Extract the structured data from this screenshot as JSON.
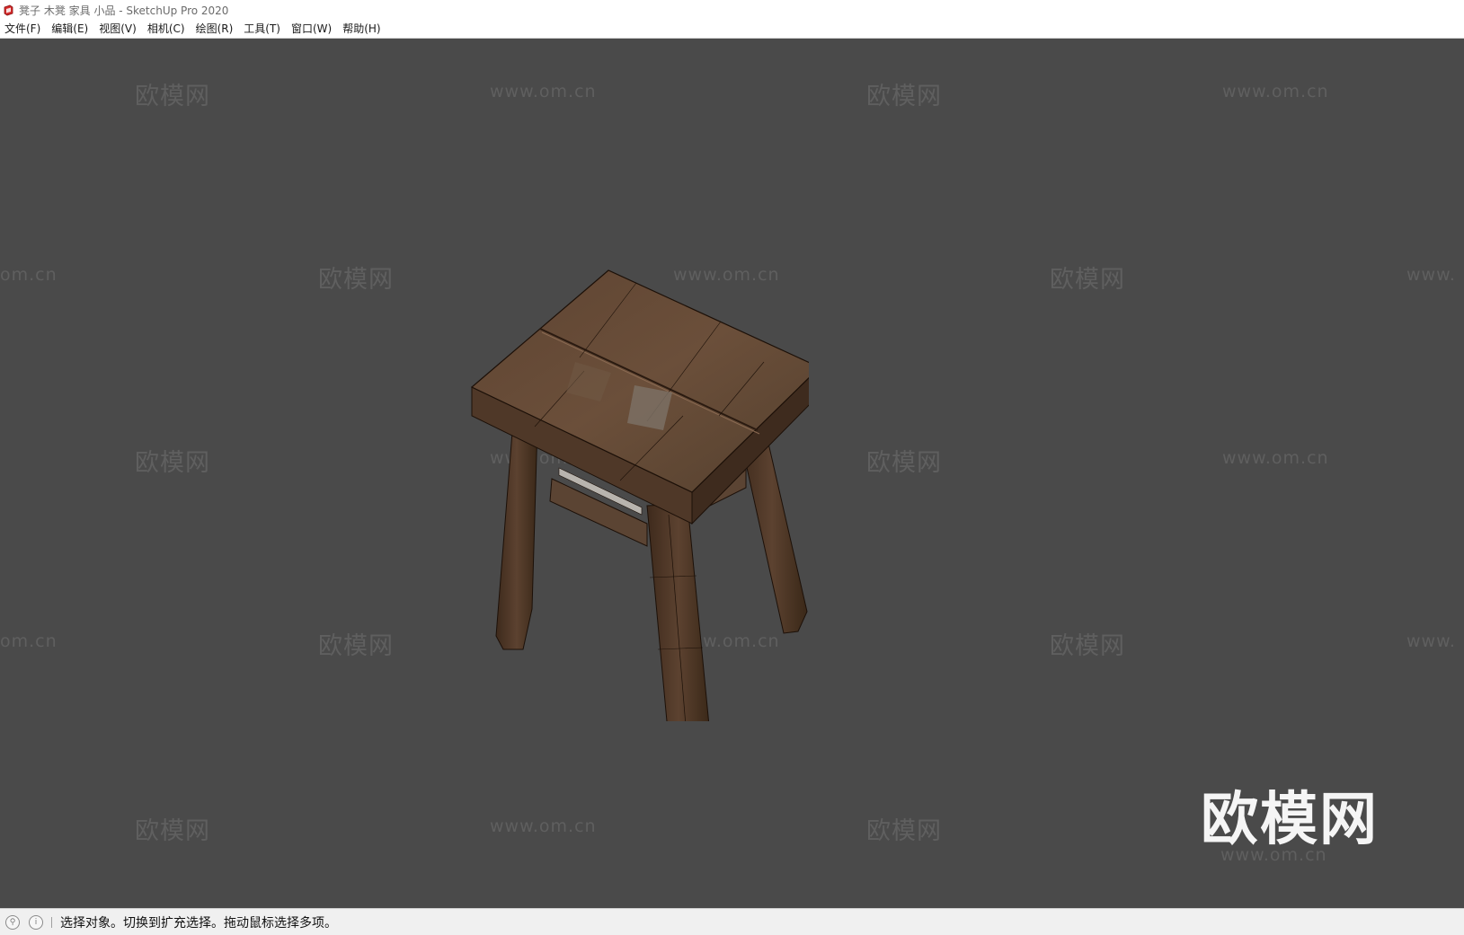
{
  "window": {
    "title": "凳子 木凳 家具 小品 - SketchUp Pro 2020"
  },
  "menu": {
    "items": [
      {
        "label": "文件(F)"
      },
      {
        "label": "编辑(E)"
      },
      {
        "label": "视图(V)"
      },
      {
        "label": "相机(C)"
      },
      {
        "label": "绘图(R)"
      },
      {
        "label": "工具(T)"
      },
      {
        "label": "窗口(W)"
      },
      {
        "label": "帮助(H)"
      }
    ]
  },
  "watermark": {
    "cn": "欧模网",
    "url": "www.om.cn",
    "url_cropped": "om.cn",
    "url_cropped_right": "www.",
    "logo": "欧模网",
    "logo_url": "www.om.cn"
  },
  "viewport": {
    "model": "wooden-stool",
    "background_color": "#4a4a4a"
  },
  "statusbar": {
    "icon_left": "geo-location-icon",
    "icon_info": "info-icon",
    "message": "选择对象。切换到扩充选择。拖动鼠标选择多项。"
  },
  "colors": {
    "app_icon": "#d32a2a",
    "wood_dark": "#4a3424",
    "wood_mid": "#6a4c36",
    "wood_light": "#7a5c44"
  }
}
